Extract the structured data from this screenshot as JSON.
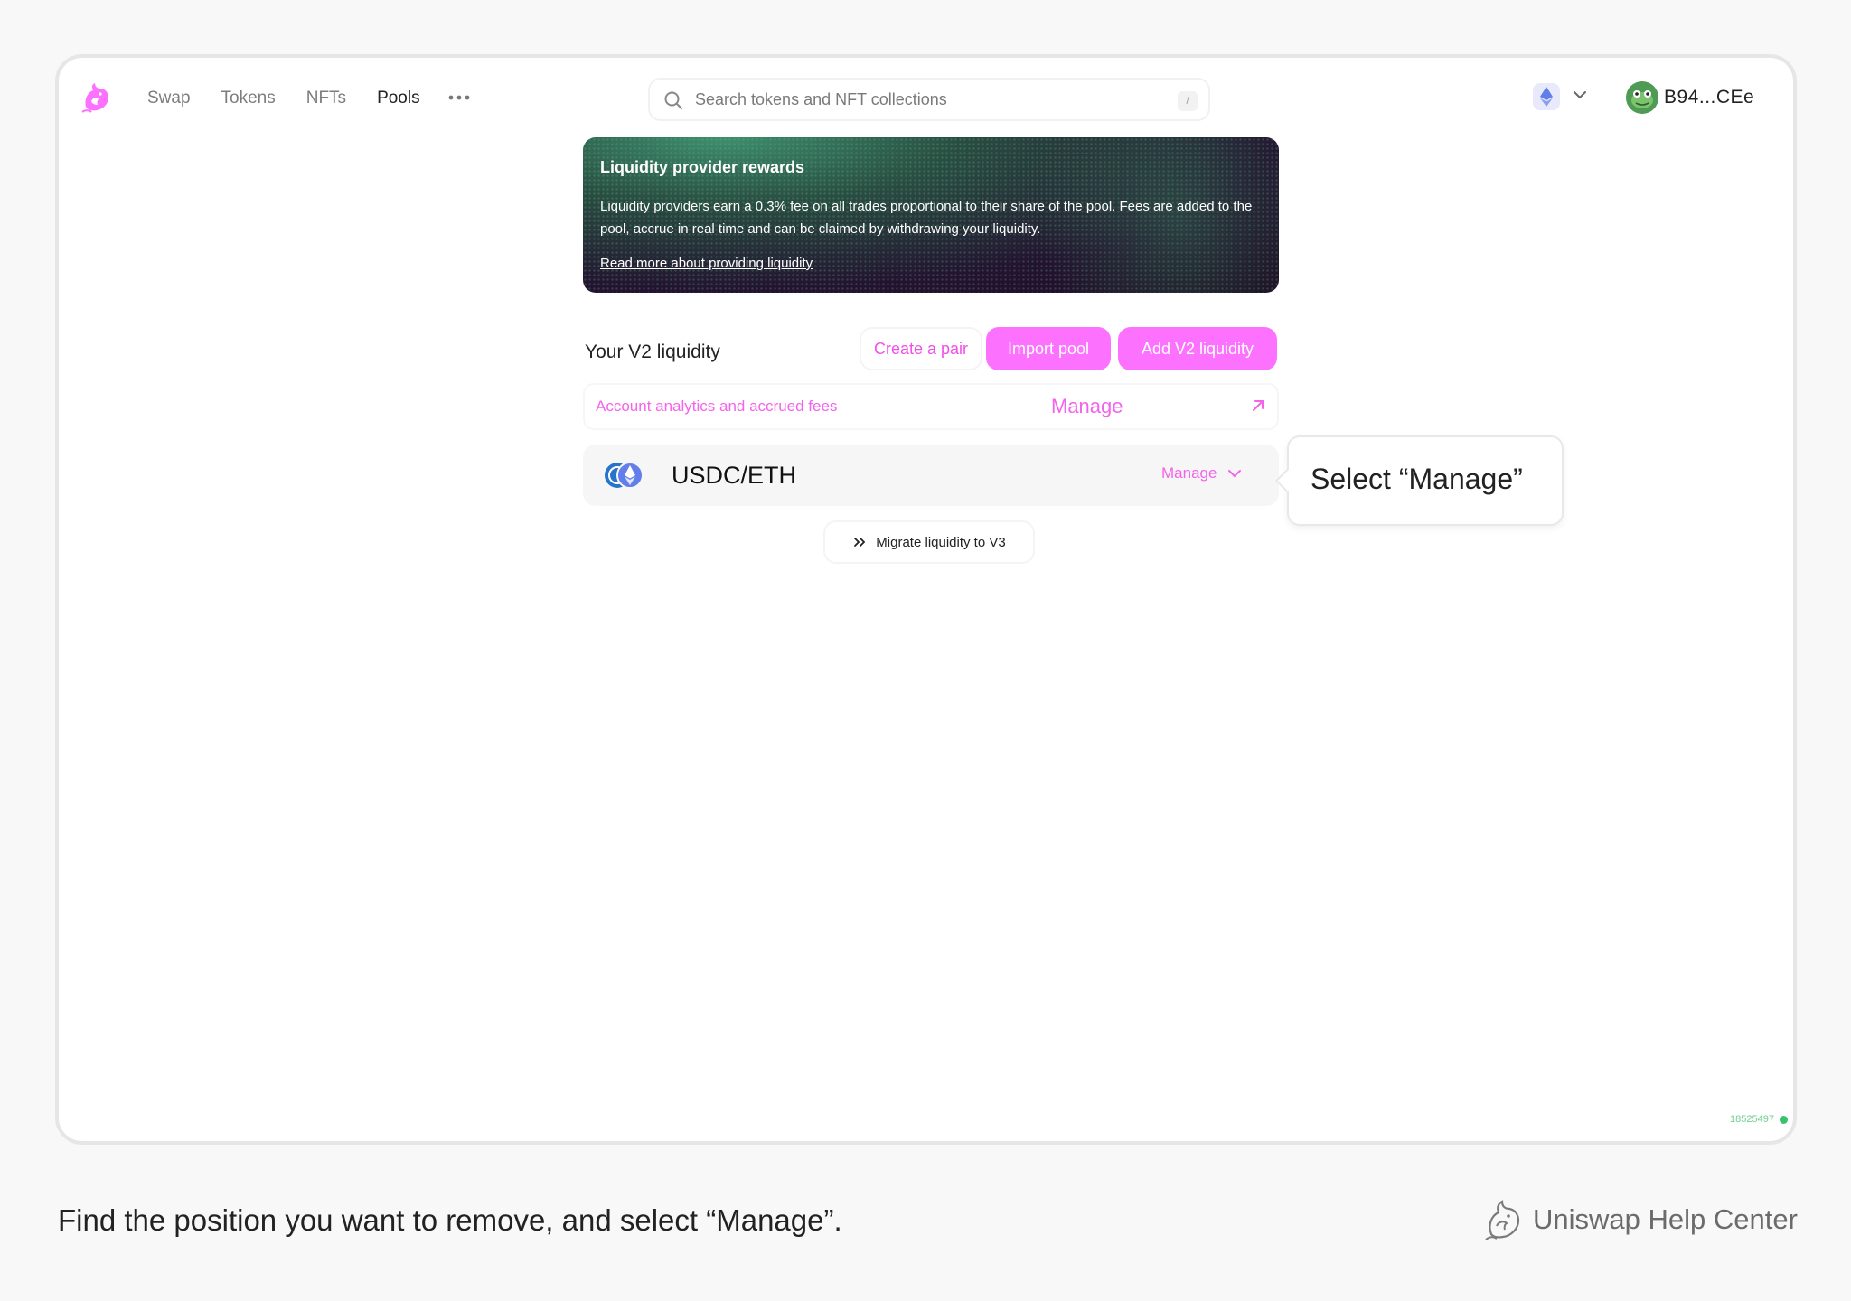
{
  "nav": {
    "links": [
      "Swap",
      "Tokens",
      "NFTs",
      "Pools"
    ],
    "active": "Pools",
    "more_icon": "ellipsis-icon",
    "logo_icon": "uniswap-unicorn-icon"
  },
  "search": {
    "placeholder": "Search tokens and NFT collections",
    "shortcut": "/"
  },
  "network": {
    "icon": "ethereum-icon"
  },
  "account": {
    "address": "B94...CEe"
  },
  "banner": {
    "title": "Liquidity provider rewards",
    "body": "Liquidity providers earn a 0.3% fee on all trades proportional to their share of the pool. Fees are added to the pool, accrue in real time and can be claimed by withdrawing your liquidity.",
    "link": "Read more about providing liquidity"
  },
  "v2": {
    "title": "Your V2 liquidity",
    "create_pair": "Create a pair",
    "import_pool": "Import pool",
    "add_liquidity": "Add V2 liquidity"
  },
  "analytics": {
    "label": "Account analytics and accrued fees",
    "manage": "Manage"
  },
  "position": {
    "pair": "USDC/ETH",
    "manage": "Manage"
  },
  "callout": {
    "text": "Select “Manage”"
  },
  "migrate": {
    "label": "Migrate liquidity to V3"
  },
  "status": {
    "block_number": "18525497"
  },
  "footer": {
    "caption": "Find the position you want to remove, and select “Manage”.",
    "brand": "Uniswap Help Center"
  },
  "colors": {
    "accent_pink": "#fc72ff",
    "pink_text": "#f363ec",
    "status_green": "#35c46d"
  }
}
